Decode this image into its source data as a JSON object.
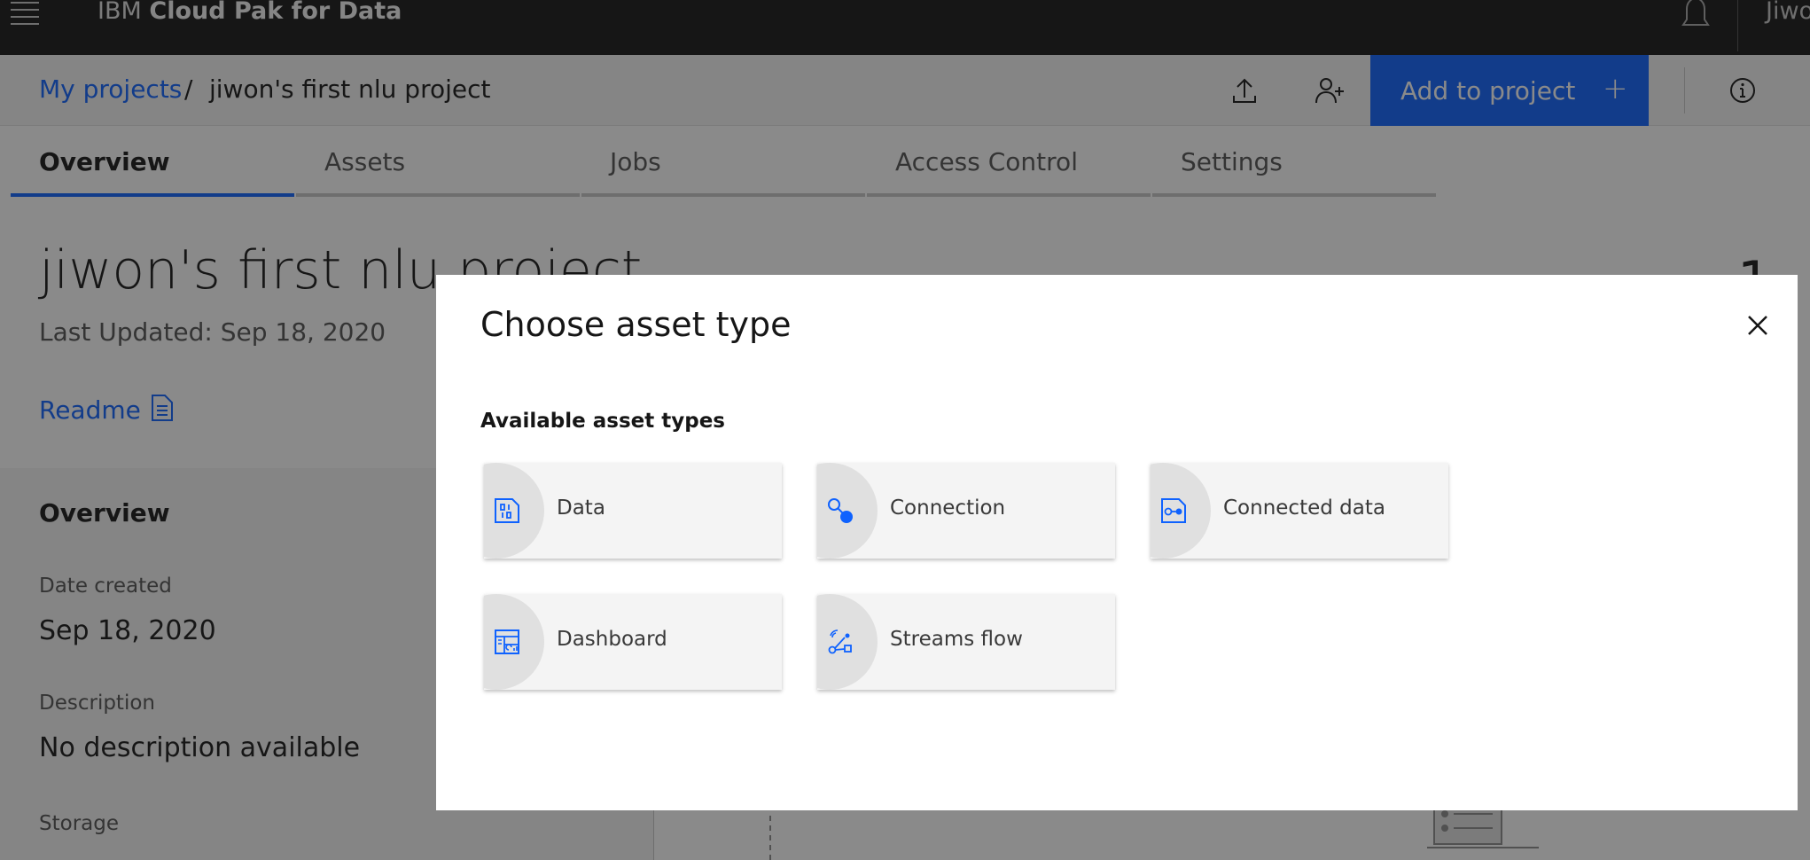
{
  "header": {
    "brand_prefix": "IBM",
    "brand_product": "Cloud Pak for Data",
    "user_partial": "Jiwo"
  },
  "breadcrumb": {
    "root": "My projects",
    "separator": "/",
    "current": "jiwon's first nlu project"
  },
  "toolbar": {
    "add_label": "Add to project",
    "add_plus": "+"
  },
  "tabs": [
    {
      "label": "Overview",
      "active": true
    },
    {
      "label": "Assets"
    },
    {
      "label": "Jobs"
    },
    {
      "label": "Access Control"
    },
    {
      "label": "Settings"
    }
  ],
  "page": {
    "title": "jiwon's first nlu project",
    "last_updated": "Last Updated: Sep 18, 2020",
    "readme": "Readme",
    "side_number": "1"
  },
  "overview": {
    "heading": "Overview",
    "date_created_label": "Date created",
    "date_created": "Sep 18, 2020",
    "description_label": "Description",
    "description": "No description available",
    "storage_label": "Storage"
  },
  "modal": {
    "title": "Choose asset type",
    "section_label": "Available asset types",
    "tiles": [
      {
        "label": "Data",
        "icon": "data-icon"
      },
      {
        "label": "Connection",
        "icon": "connection-icon"
      },
      {
        "label": "Connected data",
        "icon": "connected-data-icon"
      },
      {
        "label": "Dashboard",
        "icon": "dashboard-icon"
      },
      {
        "label": "Streams flow",
        "icon": "streams-flow-icon"
      }
    ]
  },
  "colors": {
    "accent": "#0f62fe",
    "header_bg": "#161616",
    "tile_bg": "#f4f4f4"
  }
}
